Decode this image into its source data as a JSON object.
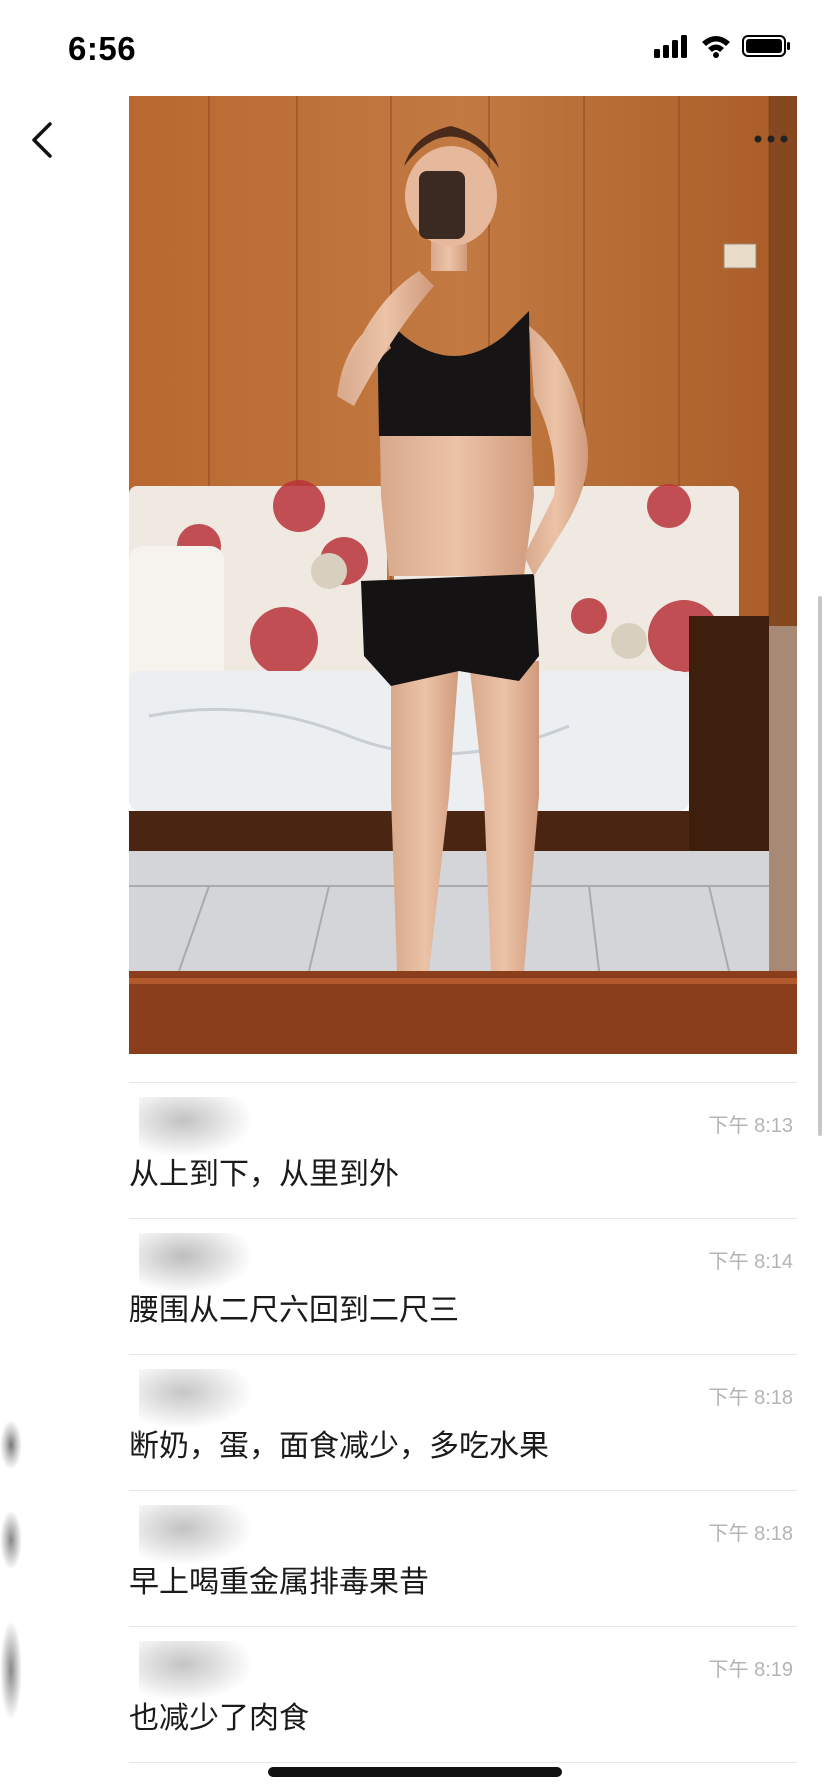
{
  "status_bar": {
    "time": "6:56",
    "icons": [
      "cellular-signal-icon",
      "wifi-icon",
      "battery-icon"
    ]
  },
  "nav": {
    "icons": [
      "back-chevron-icon",
      "more-options-icon"
    ]
  },
  "photo": {
    "description_icon": "mirror-selfie-photo"
  },
  "messages": [
    {
      "time": "下午 8:13",
      "text": "从上到下，从里到外"
    },
    {
      "time": "下午 8:14",
      "text": "腰围从二尺六回到二尺三"
    },
    {
      "time": "下午 8:18",
      "text": "断奶，蛋，面食减少，多吃水果"
    },
    {
      "time": "下午 8:18",
      "text": "早上喝重金属排毒果昔"
    },
    {
      "time": "下午 8:19",
      "text": "也减少了肉食"
    }
  ],
  "colors": {
    "wood_wall": "#b56a35",
    "text": "#1a1a1a",
    "timestamp": "#b4b4b4",
    "divider": "#e6e6e6"
  }
}
